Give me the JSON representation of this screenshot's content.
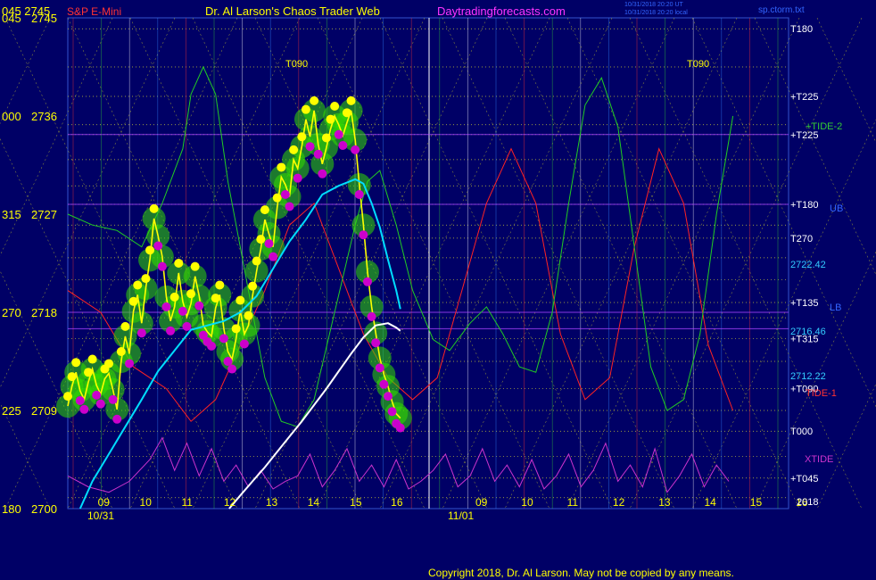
{
  "header": {
    "codes": "045 2745",
    "symbol": "S&P E-Mini",
    "title": "Dr. Al Larson's Chaos Trader Web",
    "site": "Daytradingforecasts.com",
    "stamp1": "10/31/2018 20:20 UT",
    "stamp2": "10/31/2018 20:20 local",
    "file": "sp.ctorm.txt"
  },
  "footer": {
    "copyright": "Copyright 2018, Dr. Al Larson. May not be copied by any means."
  },
  "colors": {
    "background": "#000066",
    "price_up": "#ffff00",
    "price_down": "#cc00cc",
    "bands": "#33dd00",
    "ma_fast": "#00ddff",
    "ma_slow": "#ffffff",
    "tide1": "#ff2222",
    "tide2": "#22cc22",
    "xtide": "#cc33cc"
  },
  "chart_data": {
    "type": "line",
    "ylim": [
      2700,
      2745
    ],
    "xlim": [
      8.0,
      16.8
    ],
    "y_axis_labels": [
      {
        "code": "045",
        "value": 2745
      },
      {
        "code": "000",
        "value": 2736
      },
      {
        "code": "315",
        "value": 2727
      },
      {
        "code": "270",
        "value": 2718
      },
      {
        "code": "225",
        "value": 2709
      },
      {
        "code": "180",
        "value": 2700
      }
    ],
    "x_ticks": [
      {
        "label": "09",
        "x": 8.86
      },
      {
        "label": "10",
        "x": 9.88
      },
      {
        "label": "11",
        "x": 10.9
      },
      {
        "label": "12",
        "x": 11.93
      },
      {
        "label": "13",
        "x": 12.95
      },
      {
        "label": "14",
        "x": 13.97
      },
      {
        "label": "15",
        "x": 15.0
      },
      {
        "label": "16",
        "x": 16.0
      }
    ],
    "x_ticks_forecast": [
      "09",
      "10",
      "11",
      "12",
      "13",
      "14",
      "15",
      "16"
    ],
    "date_labels": [
      "10/31",
      "11/01"
    ],
    "right_labels": [
      {
        "text": "T180",
        "value": 2744.0
      },
      {
        "text": "+T225",
        "value": 2737.8
      },
      {
        "text": "+T225",
        "value": 2734.3
      },
      {
        "text": "+T180",
        "value": 2727.9
      },
      {
        "text": "T270",
        "value": 2724.8
      },
      {
        "text": "+T135",
        "value": 2718.9
      },
      {
        "text": "+T315",
        "value": 2715.6
      },
      {
        "text": "+T090",
        "value": 2711.0
      },
      {
        "text": "T000",
        "value": 2707.1
      },
      {
        "text": "+T045",
        "value": 2702.8
      }
    ],
    "price_labels": [
      {
        "text": "2722.42",
        "value": 2722.4
      },
      {
        "text": "2716.46",
        "value": 2716.3
      },
      {
        "text": "2712.22",
        "value": 2712.2
      }
    ],
    "annotations": [
      "T090",
      "T090",
      "+TIDE-2",
      "TIDE-1",
      "XTIDE",
      "UB",
      "LB",
      "2018"
    ],
    "series": [
      {
        "name": "price",
        "x": [
          8.0,
          8.1,
          8.2,
          8.3,
          8.4,
          8.5,
          8.6,
          8.7,
          8.8,
          8.9,
          9.0,
          9.1,
          9.2,
          9.3,
          9.4,
          9.5,
          9.6,
          9.7,
          9.8,
          9.9,
          10.0,
          10.1,
          10.2,
          10.3,
          10.4,
          10.5,
          10.6,
          10.7,
          10.8,
          10.9,
          11.0,
          11.1,
          11.2,
          11.3,
          11.4,
          11.5,
          11.6,
          11.7,
          11.8,
          11.9,
          12.0,
          12.1,
          12.2,
          12.3,
          12.4,
          12.5,
          12.6,
          12.7,
          12.8,
          12.9,
          13.0,
          13.1,
          13.2,
          13.3,
          13.4,
          13.5,
          13.6,
          13.7,
          13.8,
          13.9,
          14.0,
          14.1,
          14.2,
          14.3,
          14.4,
          14.5,
          14.6,
          14.7,
          14.8,
          14.9,
          15.0,
          15.1,
          15.2,
          15.3,
          15.4,
          15.5,
          15.6,
          15.7,
          15.8,
          15.9,
          16.0,
          16.1
        ],
        "values": [
          2709.4,
          2711.2,
          2712.5,
          2710.8,
          2710.0,
          2711.6,
          2712.8,
          2711.3,
          2710.5,
          2711.9,
          2712.4,
          2710.9,
          2709.1,
          2713.5,
          2715.8,
          2714.2,
          2718.1,
          2719.6,
          2717.0,
          2720.2,
          2722.8,
          2726.6,
          2725.0,
          2723.1,
          2719.4,
          2717.2,
          2718.5,
          2721.6,
          2719.0,
          2717.6,
          2718.8,
          2721.3,
          2719.5,
          2716.8,
          2716.2,
          2715.8,
          2718.4,
          2719.6,
          2716.5,
          2714.4,
          2713.7,
          2715.6,
          2718.2,
          2716.0,
          2716.8,
          2719.5,
          2721.8,
          2723.8,
          2726.5,
          2725.2,
          2724.0,
          2727.6,
          2730.4,
          2729.7,
          2728.6,
          2732.0,
          2731.2,
          2733.2,
          2735.7,
          2734.1,
          2736.5,
          2733.4,
          2731.6,
          2733.1,
          2734.8,
          2736.0,
          2735.2,
          2734.2,
          2735.4,
          2736.5,
          2733.8,
          2729.7,
          2726.0,
          2721.7,
          2718.5,
          2716.1,
          2713.8,
          2712.3,
          2711.2,
          2709.8,
          2708.7,
          2708.3
        ]
      },
      {
        "name": "ma_fast",
        "x": [
          8.3,
          8.6,
          9.0,
          9.4,
          9.8,
          10.2,
          10.6,
          11.0,
          11.4,
          11.8,
          12.2,
          12.6,
          13.0,
          13.4,
          13.8,
          14.2,
          14.6,
          15.0,
          15.2,
          15.4,
          15.6,
          15.8,
          16.0,
          16.1
        ],
        "values": [
          2700.0,
          2702.5,
          2705.0,
          2707.5,
          2710.0,
          2712.6,
          2714.5,
          2716.4,
          2716.8,
          2717.2,
          2718.0,
          2719.5,
          2722.0,
          2724.5,
          2726.5,
          2728.8,
          2729.6,
          2730.2,
          2729.8,
          2728.0,
          2725.8,
          2722.8,
          2720.0,
          2718.3
        ]
      },
      {
        "name": "ma_slow",
        "x": [
          11.93,
          12.2,
          12.5,
          12.8,
          13.1,
          13.4,
          13.7,
          14.0,
          14.3,
          14.6,
          14.9,
          15.2,
          15.5,
          15.8,
          16.0,
          16.1
        ],
        "values": [
          2700.0,
          2701.2,
          2702.5,
          2703.8,
          2705.2,
          2706.6,
          2708.0,
          2709.5,
          2711.0,
          2712.6,
          2714.2,
          2715.7,
          2716.8,
          2717.0,
          2716.6,
          2716.3
        ]
      },
      {
        "name": "tide2",
        "x": [
          8.0,
          8.6,
          9.2,
          9.8,
          10.3,
          10.8,
          11.0,
          11.3,
          11.6,
          11.9,
          12.3,
          12.8,
          13.2,
          13.6,
          14.0,
          14.5,
          15.0,
          15.3,
          15.6,
          16.0,
          16.4,
          16.9,
          17.3,
          17.8,
          18.2,
          18.6,
          19.0,
          19.4,
          19.8,
          20.2,
          20.6,
          21.0,
          21.4,
          21.8,
          22.2,
          22.6,
          23.0,
          23.4,
          23.8,
          24.2
        ],
        "values": [
          2727.0,
          2726.0,
          2725.5,
          2724.0,
          2728.0,
          2733.0,
          2738.0,
          2740.5,
          2738.0,
          2730.0,
          2722.0,
          2712.0,
          2708.0,
          2707.5,
          2710.0,
          2718.0,
          2726.0,
          2730.0,
          2731.0,
          2726.0,
          2720.0,
          2715.5,
          2714.5,
          2717.0,
          2718.5,
          2716.0,
          2713.0,
          2712.5,
          2718.0,
          2728.0,
          2737.0,
          2739.5,
          2735.0,
          2724.0,
          2713.0,
          2709.0,
          2710.0,
          2716.0,
          2727.0,
          2736.0
        ]
      },
      {
        "name": "tide1",
        "x": [
          8.0,
          8.8,
          9.6,
          10.4,
          11.0,
          11.6,
          12.2,
          12.8,
          13.4,
          14.0,
          14.6,
          15.2,
          15.8,
          16.4,
          17.0,
          17.6,
          18.2,
          18.8,
          19.4,
          20.0,
          20.6,
          21.2,
          21.8,
          22.4,
          23.0,
          23.6,
          24.2
        ],
        "values": [
          2720.0,
          2718.0,
          2713.0,
          2711.0,
          2708.0,
          2710.0,
          2715.0,
          2720.0,
          2726.0,
          2728.0,
          2722.0,
          2716.0,
          2712.0,
          2710.0,
          2712.0,
          2720.0,
          2728.0,
          2733.0,
          2728.0,
          2716.0,
          2710.0,
          2712.0,
          2724.0,
          2733.0,
          2728.0,
          2715.0,
          2709.0
        ]
      },
      {
        "name": "xtide",
        "x": [
          8.0,
          8.5,
          9.0,
          9.5,
          10.0,
          10.3,
          10.6,
          10.9,
          11.2,
          11.5,
          11.8,
          12.1,
          12.4,
          12.7,
          13.0,
          13.3,
          13.6,
          13.9,
          14.2,
          14.5,
          14.8,
          15.1,
          15.4,
          15.7,
          16.0,
          16.3,
          16.6,
          16.9,
          17.2,
          17.5,
          17.8,
          18.1,
          18.4,
          18.7,
          19.0,
          19.3,
          19.6,
          19.9,
          20.2,
          20.5,
          20.8,
          21.1,
          21.4,
          21.7,
          22.0,
          22.3,
          22.6,
          22.9,
          23.2,
          23.5,
          23.8,
          24.1
        ],
        "values": [
          2703.0,
          2702.0,
          2701.5,
          2702.5,
          2704.5,
          2706.5,
          2703.5,
          2706.0,
          2703.0,
          2705.5,
          2702.5,
          2704.0,
          2702.0,
          2703.5,
          2701.8,
          2702.5,
          2703.0,
          2705.0,
          2702.0,
          2703.5,
          2705.5,
          2702.5,
          2704.0,
          2702.0,
          2704.5,
          2701.8,
          2702.5,
          2703.5,
          2705.0,
          2702.0,
          2703.0,
          2705.5,
          2702.5,
          2704.0,
          2702.0,
          2704.5,
          2701.8,
          2703.0,
          2705.0,
          2702.0,
          2703.5,
          2706.0,
          2702.5,
          2704.0,
          2702.0,
          2705.5,
          2701.5,
          2703.0,
          2705.0,
          2702.0,
          2704.0,
          2702.5
        ]
      }
    ]
  }
}
